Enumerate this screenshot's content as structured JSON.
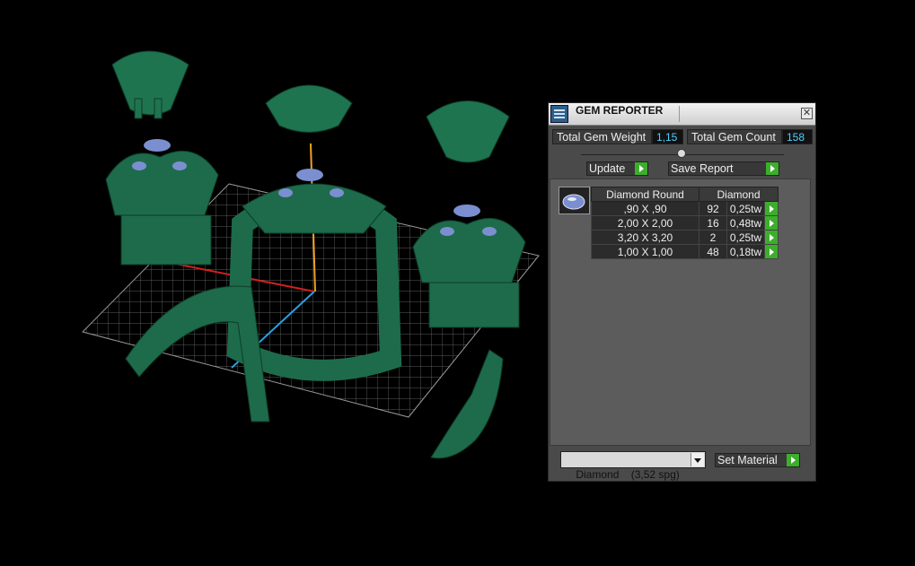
{
  "panel": {
    "title": "GEM REPORTER",
    "close_glyph": "✕",
    "total_weight_label": "Total Gem Weight",
    "total_weight_value": "1,15",
    "total_count_label": "Total Gem Count",
    "total_count_value": "158",
    "update_label": "Update",
    "save_report_label": "Save Report",
    "table": {
      "headers": [
        "Diamond Round",
        "Diamond"
      ],
      "rows": [
        {
          "size": ",90 X ,90",
          "count": "92",
          "weight": "0,25tw"
        },
        {
          "size": "2,00 X 2,00",
          "count": "16",
          "weight": "0,48tw"
        },
        {
          "size": "3,20 X 3,20",
          "count": "2",
          "weight": "0,25tw"
        },
        {
          "size": "1,00 X 1,00",
          "count": "48",
          "weight": "0,18tw"
        }
      ]
    },
    "material_value": "Diamond    (3,52 spg)",
    "set_material_label": "Set Material"
  },
  "colors": {
    "accent_green": "#3cae2b",
    "value_blue": "#4fd1ff",
    "model_green": "#1d6b4b",
    "gem_blue": "#7b8fd0"
  }
}
